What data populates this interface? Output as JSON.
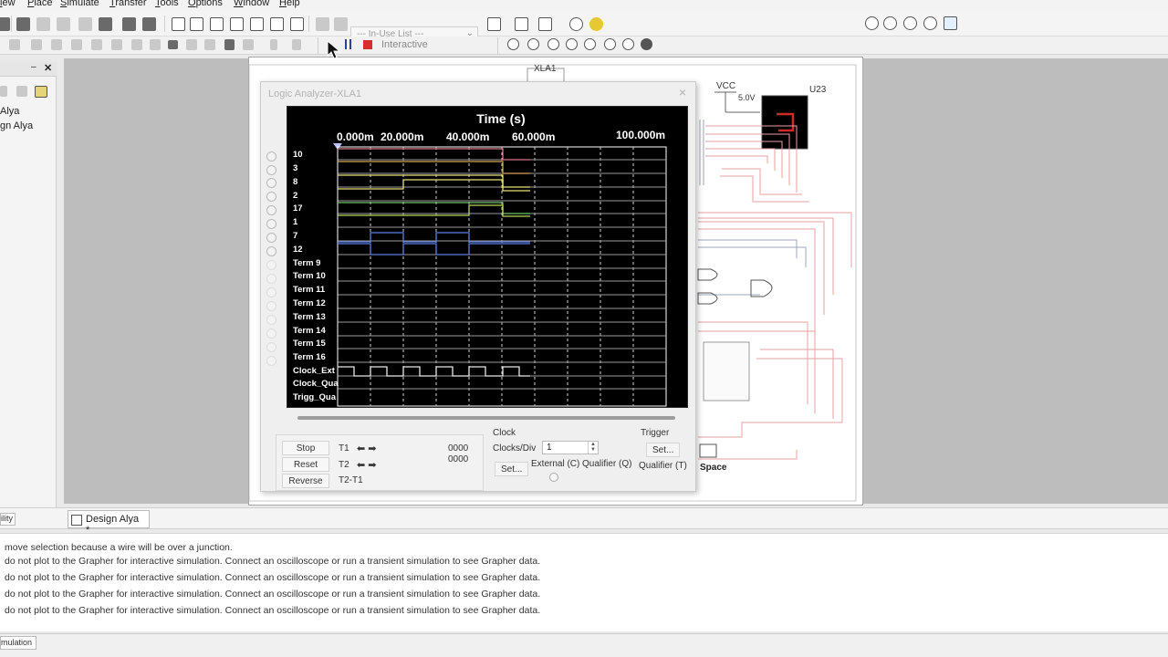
{
  "menu": [
    "iew",
    "Place",
    "Simulate",
    "Transfer",
    "Tools",
    "Options",
    "Window",
    "Help"
  ],
  "toolbar": {
    "in_use_list": "--- In-Use List ---",
    "interactive": "Interactive"
  },
  "left_panel": {
    "items": [
      "Alya",
      "gn Alya"
    ]
  },
  "schematic": {
    "xla_label": "XLA1",
    "vcc_label": "VCC",
    "voltage_label": "5.0V",
    "u23_label": "U23",
    "space_label": "Space"
  },
  "logic_analyzer": {
    "title": "Logic Analyzer-XLA1",
    "close": "×",
    "display": {
      "header": "Time (s)",
      "time_labels": [
        "0.000m",
        "20.000m",
        "40.000m",
        "60.000m",
        "100.000m"
      ],
      "channel_labels": [
        "10",
        "3",
        "8",
        "2",
        "17",
        "1",
        "7",
        "12",
        "Term 9",
        "Term 10",
        "Term 11",
        "Term 12",
        "Term 13",
        "Term 14",
        "Term 15",
        "Term 16",
        "Clock_Ext",
        "Clock_Qua",
        "Trigg_Qua"
      ]
    },
    "buttons": {
      "stop": "Stop",
      "reset": "Reset",
      "reverse": "Reverse"
    },
    "cursors": {
      "t1": "T1",
      "t2": "T2",
      "t2t1": "T2-T1",
      "t1_value": "0000",
      "t2_value": "0000"
    },
    "clock": {
      "title": "Clock",
      "clocks_div_label": "Clocks/Div",
      "clocks_div_value": "1",
      "set": "Set...",
      "external": "External (C)",
      "qualifier": "Qualifier (Q)"
    },
    "trigger": {
      "title": "Trigger",
      "set": "Set...",
      "qualifier": "Qualifier (T)"
    }
  },
  "tabs": {
    "left_tab": "ility",
    "design_tab": "Design Alya *"
  },
  "console": {
    "lines": [
      "move selection because a wire will be over a junction.",
      "do not plot to the Grapher for interactive simulation. Connect an oscilloscope or run a transient simulation to see Grapher data.",
      "do not plot to the Grapher for interactive simulation. Connect an oscilloscope or run a transient simulation to see Grapher data.",
      "do not plot to the Grapher for interactive simulation. Connect an oscilloscope or run a transient simulation to see Grapher data.",
      "do not plot to the Grapher for interactive simulation. Connect an oscilloscope or run a transient simulation to see Grapher data."
    ]
  },
  "status": {
    "tab": "mulation"
  },
  "colors": {
    "trace_red": "#d9778a",
    "trace_orange": "#d8a45a",
    "trace_yellow": "#e8e07a",
    "trace_green": "#6fc36a",
    "trace_lime": "#b9d65a",
    "trace_blue": "#5d7fe0",
    "trace_white": "#e8e8e8"
  }
}
